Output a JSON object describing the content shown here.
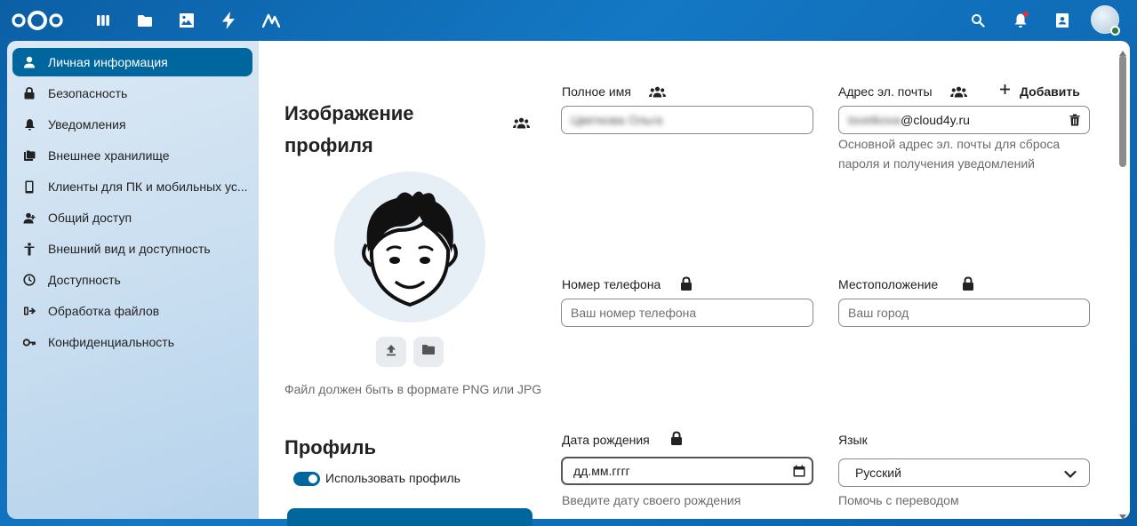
{
  "header": {
    "apps": [
      "dashboard-icon",
      "files-icon",
      "photos-icon",
      "activity-icon",
      "notes-icon"
    ],
    "right_icons": [
      "search-icon",
      "bell-icon",
      "contacts-icon"
    ],
    "accent": "#0b5fa5"
  },
  "sidebar": {
    "items": [
      {
        "label": "Личная информация",
        "icon": "person-icon",
        "active": true
      },
      {
        "label": "Безопасность",
        "icon": "lock-icon"
      },
      {
        "label": "Уведомления",
        "icon": "bell-icon"
      },
      {
        "label": "Внешнее хранилище",
        "icon": "storage-icon"
      },
      {
        "label": "Клиенты для ПК и мобильных ус...",
        "icon": "phone-icon"
      },
      {
        "label": "Общий доступ",
        "icon": "share-icon"
      },
      {
        "label": "Внешний вид и доступность",
        "icon": "accessibility-icon"
      },
      {
        "label": "Доступность",
        "icon": "clock-icon"
      },
      {
        "label": "Обработка файлов",
        "icon": "workflow-icon"
      },
      {
        "label": "Конфиденциальность",
        "icon": "key-icon"
      }
    ]
  },
  "profile_picture": {
    "title": "Изображение профиля",
    "hint": "Файл должен быть в формате PNG или JPG"
  },
  "profile": {
    "title": "Профиль",
    "toggle_label": "Использовать профиль"
  },
  "fields": {
    "fullname": {
      "label": "Полное имя",
      "value": "Цветкова Ольга"
    },
    "email": {
      "label": "Адрес эл. почты",
      "add_label": "Добавить",
      "value_hidden": "tsvetkova",
      "value_domain": "@cloud4y.ru",
      "hint": "Основной адрес эл. почты для сброса пароля и получения уведомлений"
    },
    "phone": {
      "label": "Номер телефона",
      "placeholder": "Ваш номер телефона"
    },
    "location": {
      "label": "Местоположение",
      "placeholder": "Ваш город"
    },
    "birthday": {
      "label": "Дата рождения",
      "value": "дд.мм.гггг",
      "hint": "Введите дату своего рождения"
    },
    "language": {
      "label": "Язык",
      "value": "Русский",
      "hint": "Помочь с переводом"
    }
  }
}
